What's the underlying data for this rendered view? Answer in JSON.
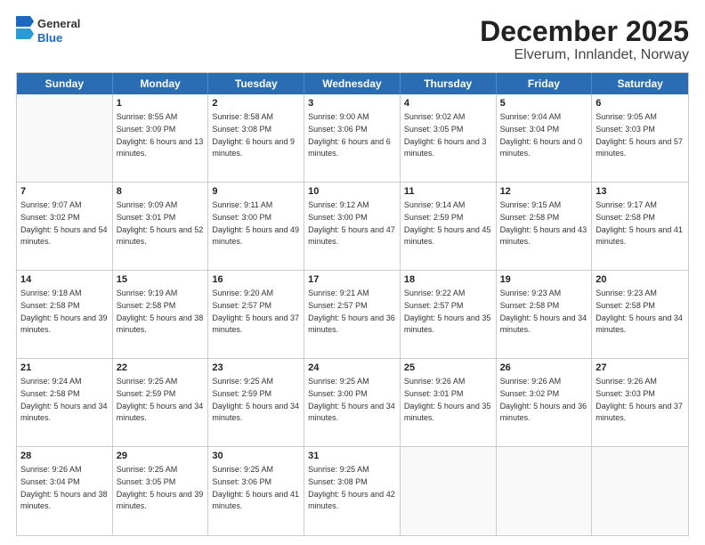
{
  "logo": {
    "line1": "General",
    "line2": "Blue"
  },
  "title": "December 2025",
  "subtitle": "Elverum, Innlandet, Norway",
  "header_days": [
    "Sunday",
    "Monday",
    "Tuesday",
    "Wednesday",
    "Thursday",
    "Friday",
    "Saturday"
  ],
  "weeks": [
    [
      {
        "day": "",
        "empty": true
      },
      {
        "day": "1",
        "sunrise": "Sunrise: 8:55 AM",
        "sunset": "Sunset: 3:09 PM",
        "daylight": "Daylight: 6 hours and 13 minutes."
      },
      {
        "day": "2",
        "sunrise": "Sunrise: 8:58 AM",
        "sunset": "Sunset: 3:08 PM",
        "daylight": "Daylight: 6 hours and 9 minutes."
      },
      {
        "day": "3",
        "sunrise": "Sunrise: 9:00 AM",
        "sunset": "Sunset: 3:06 PM",
        "daylight": "Daylight: 6 hours and 6 minutes."
      },
      {
        "day": "4",
        "sunrise": "Sunrise: 9:02 AM",
        "sunset": "Sunset: 3:05 PM",
        "daylight": "Daylight: 6 hours and 3 minutes."
      },
      {
        "day": "5",
        "sunrise": "Sunrise: 9:04 AM",
        "sunset": "Sunset: 3:04 PM",
        "daylight": "Daylight: 6 hours and 0 minutes."
      },
      {
        "day": "6",
        "sunrise": "Sunrise: 9:05 AM",
        "sunset": "Sunset: 3:03 PM",
        "daylight": "Daylight: 5 hours and 57 minutes."
      }
    ],
    [
      {
        "day": "7",
        "sunrise": "Sunrise: 9:07 AM",
        "sunset": "Sunset: 3:02 PM",
        "daylight": "Daylight: 5 hours and 54 minutes."
      },
      {
        "day": "8",
        "sunrise": "Sunrise: 9:09 AM",
        "sunset": "Sunset: 3:01 PM",
        "daylight": "Daylight: 5 hours and 52 minutes."
      },
      {
        "day": "9",
        "sunrise": "Sunrise: 9:11 AM",
        "sunset": "Sunset: 3:00 PM",
        "daylight": "Daylight: 5 hours and 49 minutes."
      },
      {
        "day": "10",
        "sunrise": "Sunrise: 9:12 AM",
        "sunset": "Sunset: 3:00 PM",
        "daylight": "Daylight: 5 hours and 47 minutes."
      },
      {
        "day": "11",
        "sunrise": "Sunrise: 9:14 AM",
        "sunset": "Sunset: 2:59 PM",
        "daylight": "Daylight: 5 hours and 45 minutes."
      },
      {
        "day": "12",
        "sunrise": "Sunrise: 9:15 AM",
        "sunset": "Sunset: 2:58 PM",
        "daylight": "Daylight: 5 hours and 43 minutes."
      },
      {
        "day": "13",
        "sunrise": "Sunrise: 9:17 AM",
        "sunset": "Sunset: 2:58 PM",
        "daylight": "Daylight: 5 hours and 41 minutes."
      }
    ],
    [
      {
        "day": "14",
        "sunrise": "Sunrise: 9:18 AM",
        "sunset": "Sunset: 2:58 PM",
        "daylight": "Daylight: 5 hours and 39 minutes."
      },
      {
        "day": "15",
        "sunrise": "Sunrise: 9:19 AM",
        "sunset": "Sunset: 2:58 PM",
        "daylight": "Daylight: 5 hours and 38 minutes."
      },
      {
        "day": "16",
        "sunrise": "Sunrise: 9:20 AM",
        "sunset": "Sunset: 2:57 PM",
        "daylight": "Daylight: 5 hours and 37 minutes."
      },
      {
        "day": "17",
        "sunrise": "Sunrise: 9:21 AM",
        "sunset": "Sunset: 2:57 PM",
        "daylight": "Daylight: 5 hours and 36 minutes."
      },
      {
        "day": "18",
        "sunrise": "Sunrise: 9:22 AM",
        "sunset": "Sunset: 2:57 PM",
        "daylight": "Daylight: 5 hours and 35 minutes."
      },
      {
        "day": "19",
        "sunrise": "Sunrise: 9:23 AM",
        "sunset": "Sunset: 2:58 PM",
        "daylight": "Daylight: 5 hours and 34 minutes."
      },
      {
        "day": "20",
        "sunrise": "Sunrise: 9:23 AM",
        "sunset": "Sunset: 2:58 PM",
        "daylight": "Daylight: 5 hours and 34 minutes."
      }
    ],
    [
      {
        "day": "21",
        "sunrise": "Sunrise: 9:24 AM",
        "sunset": "Sunset: 2:58 PM",
        "daylight": "Daylight: 5 hours and 34 minutes."
      },
      {
        "day": "22",
        "sunrise": "Sunrise: 9:25 AM",
        "sunset": "Sunset: 2:59 PM",
        "daylight": "Daylight: 5 hours and 34 minutes."
      },
      {
        "day": "23",
        "sunrise": "Sunrise: 9:25 AM",
        "sunset": "Sunset: 2:59 PM",
        "daylight": "Daylight: 5 hours and 34 minutes."
      },
      {
        "day": "24",
        "sunrise": "Sunrise: 9:25 AM",
        "sunset": "Sunset: 3:00 PM",
        "daylight": "Daylight: 5 hours and 34 minutes."
      },
      {
        "day": "25",
        "sunrise": "Sunrise: 9:26 AM",
        "sunset": "Sunset: 3:01 PM",
        "daylight": "Daylight: 5 hours and 35 minutes."
      },
      {
        "day": "26",
        "sunrise": "Sunrise: 9:26 AM",
        "sunset": "Sunset: 3:02 PM",
        "daylight": "Daylight: 5 hours and 36 minutes."
      },
      {
        "day": "27",
        "sunrise": "Sunrise: 9:26 AM",
        "sunset": "Sunset: 3:03 PM",
        "daylight": "Daylight: 5 hours and 37 minutes."
      }
    ],
    [
      {
        "day": "28",
        "sunrise": "Sunrise: 9:26 AM",
        "sunset": "Sunset: 3:04 PM",
        "daylight": "Daylight: 5 hours and 38 minutes."
      },
      {
        "day": "29",
        "sunrise": "Sunrise: 9:25 AM",
        "sunset": "Sunset: 3:05 PM",
        "daylight": "Daylight: 5 hours and 39 minutes."
      },
      {
        "day": "30",
        "sunrise": "Sunrise: 9:25 AM",
        "sunset": "Sunset: 3:06 PM",
        "daylight": "Daylight: 5 hours and 41 minutes."
      },
      {
        "day": "31",
        "sunrise": "Sunrise: 9:25 AM",
        "sunset": "Sunset: 3:08 PM",
        "daylight": "Daylight: 5 hours and 42 minutes."
      },
      {
        "day": "",
        "empty": true
      },
      {
        "day": "",
        "empty": true
      },
      {
        "day": "",
        "empty": true
      }
    ]
  ]
}
